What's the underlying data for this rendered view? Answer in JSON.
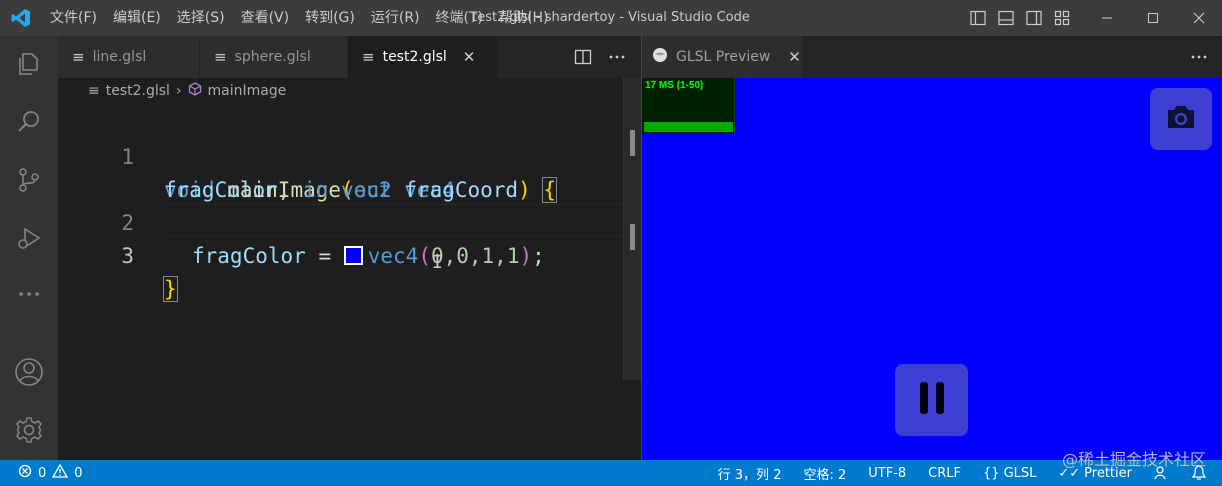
{
  "app": {
    "window_title": "test2.glsl - shardertoy - Visual Studio Code",
    "accent": "#007acc"
  },
  "menu": [
    "文件(F)",
    "编辑(E)",
    "选择(S)",
    "查看(V)",
    "转到(G)",
    "运行(R)",
    "终端(T)",
    "帮助(H)"
  ],
  "editor": {
    "tabs": [
      {
        "label": "line.glsl",
        "icon": "file-lines-icon",
        "active": false
      },
      {
        "label": "sphere.glsl",
        "icon": "file-lines-icon",
        "active": false
      },
      {
        "label": "test2.glsl",
        "icon": "file-lines-icon",
        "active": true
      }
    ],
    "breadcrumb": {
      "file": "test2.glsl",
      "symbol": "mainImage"
    },
    "line_numbers": [
      "1",
      "2",
      "3"
    ],
    "code": {
      "l1a": {
        "kw1": "void",
        "fn": "mainImage",
        "open": "(",
        "kw2": "out",
        "type": "vec4"
      },
      "l1b": {
        "var": "fragColor",
        "comma": ", ",
        "kw": "in",
        "type": "vec2",
        "var2": "fragCoord",
        "close": ")",
        "brace": "{"
      },
      "l2": {
        "var": "fragColor",
        "eq": " = ",
        "fn": "vec4",
        "open": "(",
        "args": "0,0,1,1",
        "close": ")",
        "semi": ";"
      },
      "l3": {
        "brace": "}"
      }
    },
    "color_swatch": "#0000ff"
  },
  "preview": {
    "tab_label": "GLSL Preview",
    "stats_label": "17 MS (1-50)",
    "background": "#0000ff"
  },
  "status": {
    "errors": "0",
    "warnings": "0",
    "position": "行 3，列 2",
    "spaces": "空格: 2",
    "encoding": "UTF-8",
    "eol": "CRLF",
    "language": "GLSL",
    "formatter": "Prettier"
  },
  "watermark": "@稀土掘金技术社区"
}
